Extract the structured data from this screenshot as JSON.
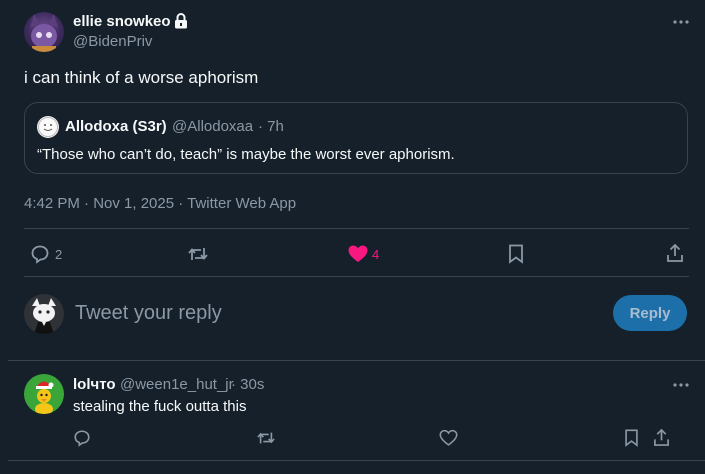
{
  "tweet": {
    "author_name": "ellie snowkeo",
    "author_handle": "@BidenPriv",
    "text": "i can think of a worse aphorism",
    "meta": "4:42 PM · Nov 1, 2025 · Twitter Web App",
    "more_icon": "more-dots-icon",
    "lock_icon": "lock-icon",
    "actions": {
      "reply_count": "2",
      "like_count": "4",
      "like_color": "#f91880"
    }
  },
  "quoted": {
    "author_name": "Allodoxa (S3r)",
    "author_handle": "@Allodoxaa",
    "time": "· 7h",
    "text": "“Those who can’t do, teach” is maybe the worst ever aphorism."
  },
  "compose": {
    "placeholder": "Tweet your reply",
    "button_label": "Reply",
    "button_color": "#1d6fa9"
  },
  "reply": {
    "author_name": "lolчто",
    "author_handle": "@ween1e_hut_jr",
    "time": "· 30s",
    "text": "stealing the fuck outta this"
  }
}
